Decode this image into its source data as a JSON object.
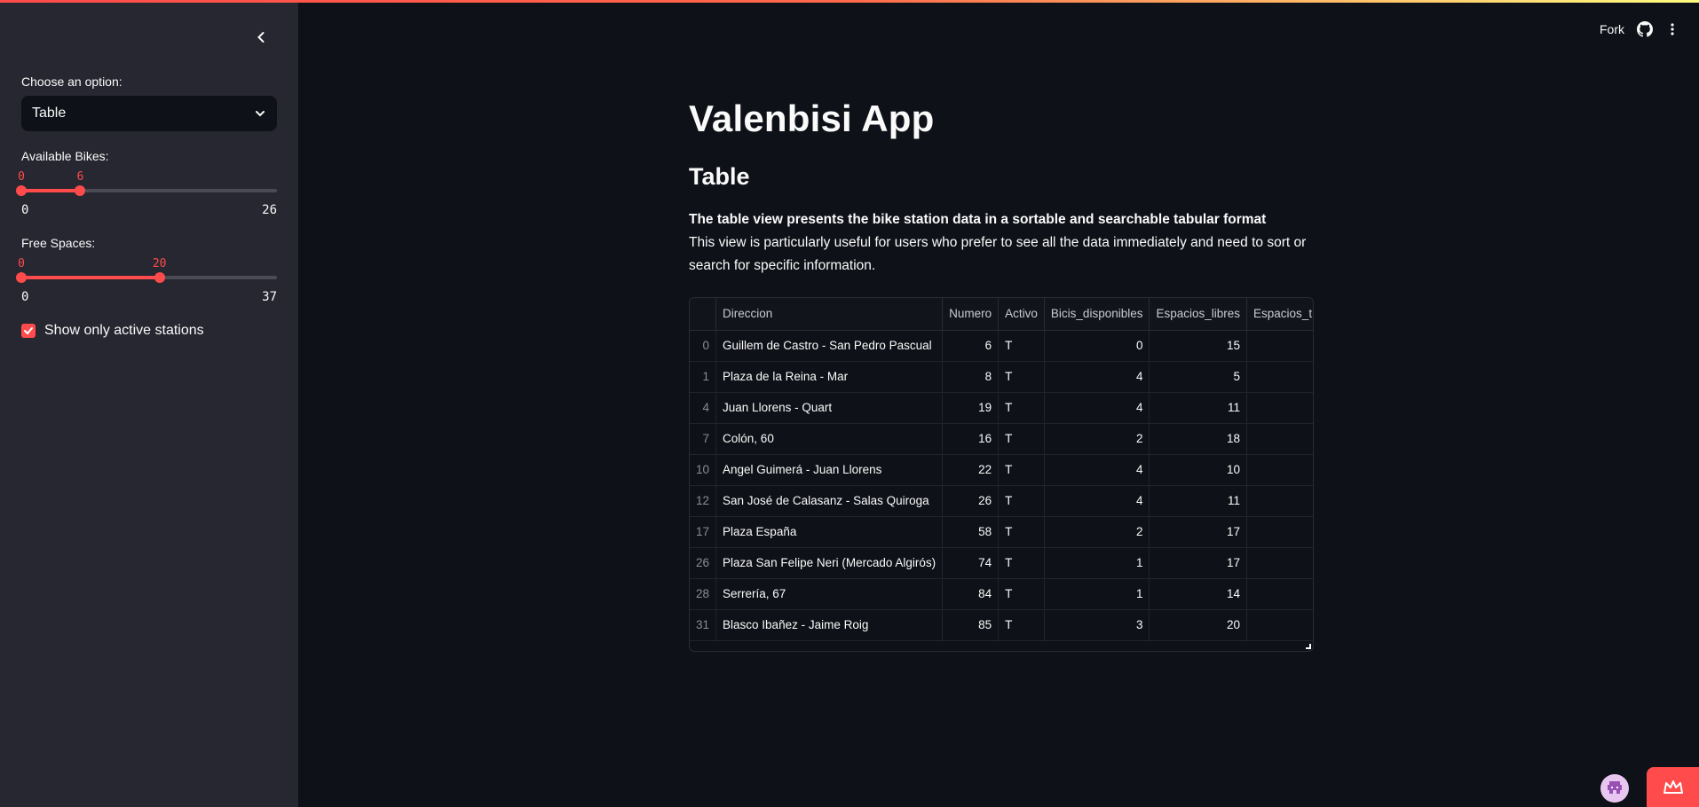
{
  "sidebar": {
    "select": {
      "label": "Choose an option:",
      "value": "Table"
    },
    "bikes_slider": {
      "label": "Available Bikes:",
      "min": 0,
      "max": 26,
      "low": 0,
      "high": 6,
      "min_label": "0",
      "max_label": "26",
      "low_label": "0",
      "high_label": "6"
    },
    "spaces_slider": {
      "label": "Free Spaces:",
      "min": 0,
      "max": 37,
      "low": 0,
      "high": 20,
      "min_label": "0",
      "max_label": "37",
      "low_label": "0",
      "high_label": "20"
    },
    "checkbox": {
      "label": "Show only active stations",
      "checked": true
    }
  },
  "header": {
    "fork_label": "Fork"
  },
  "main": {
    "title": "Valenbisi App",
    "section": "Table",
    "desc_bold": "The table view presents the bike station data in a sortable and searchable tabular format",
    "desc_text": "This view is particularly useful for users who prefer to see all the data immediately and need to sort or search for specific information."
  },
  "table": {
    "columns": [
      "",
      "Direccion",
      "Numero",
      "Activo",
      "Bicis_disponibles",
      "Espacios_libres",
      "Espacios_t"
    ],
    "rows": [
      [
        "0",
        "Guillem de Castro - San Pedro Pascual",
        "6",
        "T",
        "0",
        "15"
      ],
      [
        "1",
        "Plaza de la Reina - Mar",
        "8",
        "T",
        "4",
        "5"
      ],
      [
        "4",
        "Juan Llorens - Quart",
        "19",
        "T",
        "4",
        "11"
      ],
      [
        "7",
        "Colón, 60",
        "16",
        "T",
        "2",
        "18"
      ],
      [
        "10",
        "Angel Guimerá - Juan Llorens",
        "22",
        "T",
        "4",
        "10"
      ],
      [
        "12",
        "San José de Calasanz - Salas Quiroga",
        "26",
        "T",
        "4",
        "11"
      ],
      [
        "17",
        "Plaza España",
        "58",
        "T",
        "2",
        "17"
      ],
      [
        "26",
        "Plaza San Felipe Neri (Mercado Algirós)",
        "74",
        "T",
        "1",
        "17"
      ],
      [
        "28",
        "Serrería, 67",
        "84",
        "T",
        "1",
        "14"
      ],
      [
        "31",
        "Blasco Ibañez - Jaime Roig",
        "85",
        "T",
        "3",
        "20"
      ]
    ]
  },
  "colors": {
    "accent": "#ff4b4b",
    "sidebar_bg": "#262730",
    "main_bg": "#0e1117"
  },
  "icons": {
    "collapse": "chevron-left-icon",
    "github": "github-icon",
    "menu": "kebab-menu-icon",
    "dropdown": "chevron-down-icon"
  }
}
